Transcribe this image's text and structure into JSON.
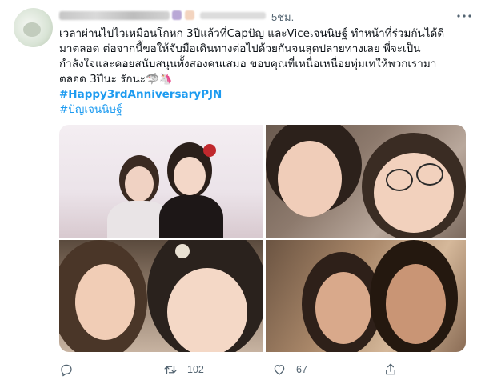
{
  "header": {
    "timestamp": "5ชม."
  },
  "tweet": {
    "lines": [
      "เวลาผ่านไปไวเหมือนโกหก 3ปีแล้วที่Capปัญ และViceเจนนิษฐ์ ทำหน้าที่ร่วมกันได้ดี",
      "มาตลอด ต่อจากนี้ขอให้จับมือเดินทางต่อไปด้วยกันจนสุดปลายทางเลย พี่จะเป็น",
      "กำลังใจและคอยสนับสนุนทั้งสองคนเสมอ ขอบคุณที่เหนื่อเหนื่อยทุ่มเทให้พวกเรามา",
      "ตลอด 3ปีนะ รักนะ🦈🦄"
    ],
    "hashtags": [
      "#Happy3rdAnniversaryPJN",
      "#ปัญเจนนิษฐ์"
    ]
  },
  "media": {
    "photos": [
      "photo-1",
      "photo-2",
      "photo-3",
      "photo-4"
    ]
  },
  "actions": {
    "reply_icon": "reply-icon",
    "retweet_icon": "retweet-icon",
    "retweet_count": "102",
    "like_icon": "like-icon",
    "like_count": "67",
    "share_icon": "share-icon"
  },
  "colors": {
    "accent": "#1d9bf0",
    "muted": "#536471"
  }
}
